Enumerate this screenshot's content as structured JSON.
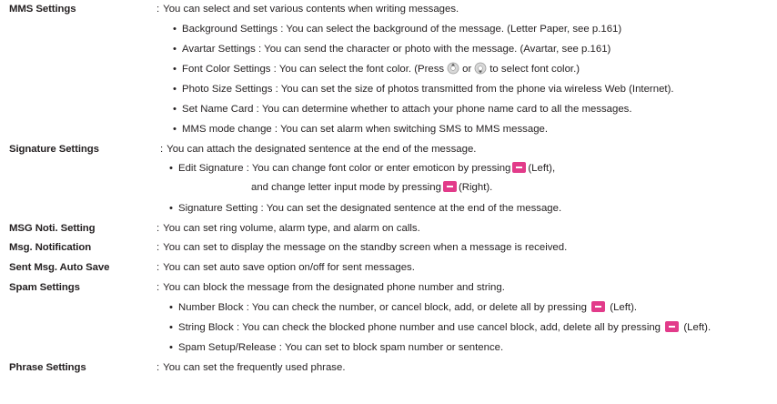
{
  "colon": ":",
  "entries": {
    "mms": {
      "term": "MMS Settings",
      "desc": "You can select and set various contents when writing messages.",
      "bullets": [
        {
          "label": "Background Settings :",
          "text": "You can select the background of the message. (Letter Paper, see p.161)"
        },
        {
          "label": "Avartar Settings :",
          "text": "You can send the character or photo with the message. (Avartar, see p.161)"
        },
        {
          "label": "Font Color Settings :",
          "text_a": "You can select the font color. (Press",
          "or": "or",
          "text_b": "to select font color.)"
        },
        {
          "label": "Photo Size Settings :",
          "text": "You can set the size of photos transmitted from the phone via wireless Web (Internet)."
        },
        {
          "label": "Set Name Card :",
          "text": "You can determine whether to attach your phone name card to all the messages."
        },
        {
          "label": "MMS mode change :",
          "text": "You can set alarm when switching SMS to MMS message."
        }
      ]
    },
    "signature": {
      "term": "Signature Settings",
      "desc": "You can attach the designated sentence at the end of the message.",
      "edit": {
        "label": "Edit Signature :",
        "text_a": "You can change font color or enter emoticon by pressing",
        "text_b": "(Left),",
        "line2_a": "and change letter input mode by pressing",
        "line2_b": "(Right)."
      },
      "setting": {
        "label": "Signature Setting :",
        "text": "You can set the designated sentence at the end of the message."
      }
    },
    "noti": {
      "term": "MSG Noti. Setting",
      "desc": "You can set ring volume, alarm type, and alarm on calls."
    },
    "notification": {
      "term": "Msg. Notification",
      "desc": "You can set to display the message on the standby screen when a message is received."
    },
    "autosave": {
      "term": "Sent Msg. Auto Save",
      "desc": "You can set auto save option on/off for sent messages."
    },
    "spam": {
      "term": "Spam Settings",
      "desc": "You can block the message from the designated phone number and string.",
      "number": {
        "label": "Number Block :",
        "text_a": "You can check the number, or cancel block, add, or delete all by pressing",
        "text_b": "(Left)."
      },
      "string": {
        "label": "String Block :",
        "text_a": "You can check the blocked phone number and use cancel block, add, delete all by pressing",
        "text_b": "(Left)."
      },
      "release": {
        "label": "Spam Setup/Release :",
        "text": "You can set to block spam number or sentence."
      }
    },
    "phrase": {
      "term": "Phrase Settings",
      "desc": "You can set the frequently used phrase."
    }
  },
  "colors": {
    "text": "#231f20",
    "button": "#e23b8a"
  },
  "icons": [
    "bullet-icon",
    "soft-key-icon",
    "nav-key-up-icon",
    "nav-key-down-icon"
  ]
}
